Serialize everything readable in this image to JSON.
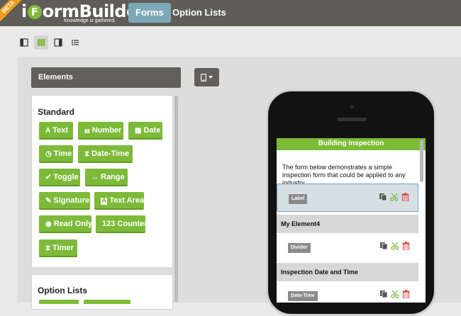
{
  "app": {
    "logo_text_1": "i",
    "logo_text_2": "orm",
    "logo_text_3": "Builder",
    "logo_mark": "F",
    "tagline": "Knowledge is gathered.",
    "beta": "BETA"
  },
  "nav": {
    "tabs": [
      {
        "label": "Forms"
      },
      {
        "label": "Option Lists"
      }
    ]
  },
  "layout_buttons": [
    {
      "icon": "left-panel-icon"
    },
    {
      "icon": "three-column-icon"
    },
    {
      "icon": "right-panel-icon"
    },
    {
      "icon": "list-icon"
    }
  ],
  "elements_panel": {
    "header": "Elements",
    "standard_title": "Standard",
    "standard": [
      {
        "label": "Text",
        "icon": "A"
      },
      {
        "label": "Number",
        "icon": "▮▮"
      },
      {
        "label": "Date",
        "icon": "▦"
      },
      {
        "label": "Time",
        "icon": "◷"
      },
      {
        "label": "Date-Time",
        "icon": "⧗"
      },
      {
        "label": "Toggle",
        "icon": "✔"
      },
      {
        "label": "Range",
        "icon": "↔"
      },
      {
        "label": "Signature",
        "icon": "✎"
      },
      {
        "label": "Text Area",
        "icon": "A"
      },
      {
        "label": "Read Only",
        "icon": "◉"
      },
      {
        "label": "123 Counter",
        "icon": ""
      },
      {
        "label": "Timer",
        "icon": "⧗"
      }
    ],
    "option_lists_title": "Option Lists"
  },
  "preview": {
    "form_title": "Building Inspection",
    "intro": "The form below demonstrates a simple inspection form that could be applied to any industry.",
    "rows": [
      {
        "tag": "Label"
      },
      {
        "section": "My Element4"
      },
      {
        "tag": "Divider"
      },
      {
        "section": "Inspection Date and Time"
      },
      {
        "tag": "Date-Time"
      }
    ]
  },
  "colors": {
    "accent_green": "#7dba39",
    "header_bg": "#5f5d58",
    "active_tab": "#7da9b7",
    "delete_red": "#d9534f",
    "cut_green": "#7dba39"
  }
}
